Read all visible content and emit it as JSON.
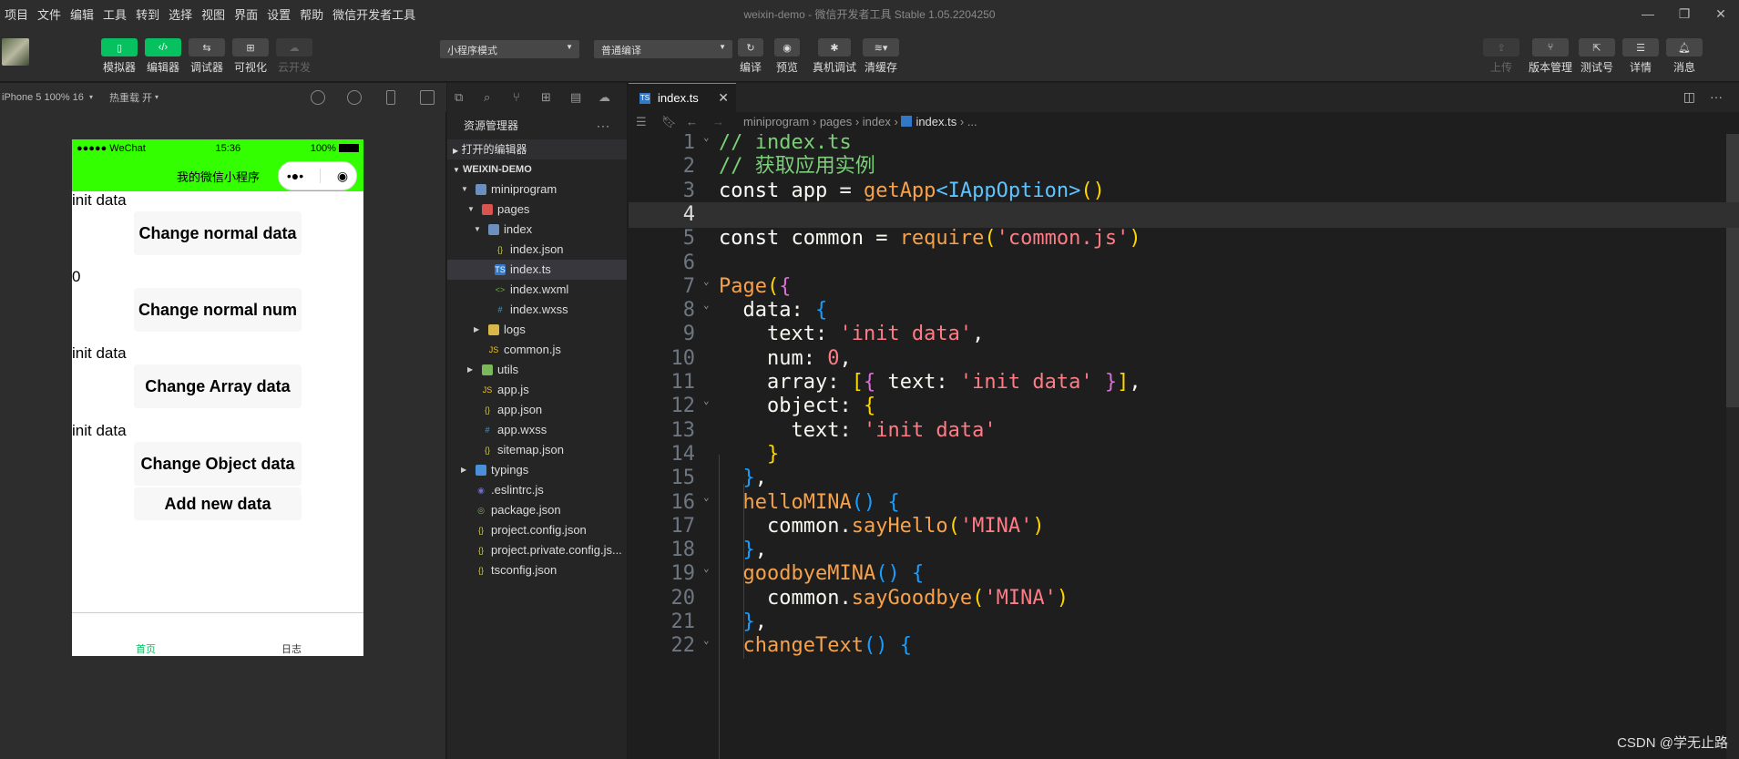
{
  "menubar": {
    "items": [
      "项目",
      "文件",
      "编辑",
      "工具",
      "转到",
      "选择",
      "视图",
      "界面",
      "设置",
      "帮助",
      "微信开发者工具"
    ],
    "title": "weixin-demo - 微信开发者工具 Stable 1.05.2204250"
  },
  "toolbar": {
    "left_buttons": [
      {
        "label": "模拟器",
        "icon": "phone-icon",
        "active": true
      },
      {
        "label": "编辑器",
        "icon": "code-icon",
        "active": true
      },
      {
        "label": "调试器",
        "icon": "debug-icon",
        "active": false
      },
      {
        "label": "可视化",
        "icon": "layout-icon",
        "active": false
      },
      {
        "label": "云开发",
        "icon": "cloud-icon",
        "disabled": true
      }
    ],
    "mode_select": "小程序模式",
    "compile_select": "普通编译",
    "mid_buttons": [
      {
        "label": "编译",
        "icon": "refresh-icon"
      },
      {
        "label": "预览",
        "icon": "eye-icon"
      },
      {
        "label": "真机调试",
        "icon": "bug-icon"
      },
      {
        "label": "清缓存",
        "icon": "layers-icon"
      }
    ],
    "right_buttons": [
      {
        "label": "上传",
        "icon": "upload-icon",
        "disabled": true
      },
      {
        "label": "版本管理",
        "icon": "branch-icon"
      },
      {
        "label": "测试号",
        "icon": "external-icon"
      },
      {
        "label": "详情",
        "icon": "menu-icon"
      },
      {
        "label": "消息",
        "icon": "bell-icon"
      }
    ]
  },
  "simulator": {
    "device": "iPhone 5 100% 16",
    "hotreload": "热重载 开",
    "status_left": "●●●●● WeChat",
    "status_time": "15:36",
    "status_battery": "100%",
    "nav_title": "我的微信小程序",
    "capsule_dots": "•●•",
    "capsule_target": "◉",
    "items": [
      {
        "text": "init data",
        "button": "Change normal data"
      },
      {
        "text": "0",
        "button": "Change normal num"
      },
      {
        "text": "init data",
        "button": "Change Array data"
      },
      {
        "text": "init data",
        "button": "Change Object data"
      }
    ],
    "extra_button": "Add new data",
    "tabbar": [
      "首页",
      "日志"
    ],
    "colors": {
      "navbar": "#33ff00",
      "tab_active": "#07c160"
    }
  },
  "explorer": {
    "header": "资源管理器",
    "open_editors": "打开的编辑器",
    "project": "WEIXIN-DEMO",
    "tree": [
      {
        "name": "miniprogram",
        "depth": 1,
        "type": "folder",
        "open": true
      },
      {
        "name": "pages",
        "depth": 2,
        "type": "folder-red",
        "open": true
      },
      {
        "name": "index",
        "depth": 3,
        "type": "folder",
        "open": true
      },
      {
        "name": "index.json",
        "depth": 4,
        "type": "json"
      },
      {
        "name": "index.ts",
        "depth": 4,
        "type": "ts",
        "selected": true
      },
      {
        "name": "index.wxml",
        "depth": 4,
        "type": "wxml"
      },
      {
        "name": "index.wxss",
        "depth": 4,
        "type": "wxss"
      },
      {
        "name": "logs",
        "depth": 3,
        "type": "folder-yellow",
        "open": false
      },
      {
        "name": "common.js",
        "depth": 3,
        "type": "js"
      },
      {
        "name": "utils",
        "depth": 2,
        "type": "folder-green",
        "open": false
      },
      {
        "name": "app.js",
        "depth": 2,
        "type": "js"
      },
      {
        "name": "app.json",
        "depth": 2,
        "type": "json"
      },
      {
        "name": "app.wxss",
        "depth": 2,
        "type": "wxss"
      },
      {
        "name": "sitemap.json",
        "depth": 2,
        "type": "json"
      },
      {
        "name": "typings",
        "depth": 1,
        "type": "folder-blue",
        "open": false
      },
      {
        "name": ".eslintrc.js",
        "depth": 1,
        "type": "eslint"
      },
      {
        "name": "package.json",
        "depth": 1,
        "type": "package"
      },
      {
        "name": "project.config.json",
        "depth": 1,
        "type": "json"
      },
      {
        "name": "project.private.config.js...",
        "depth": 1,
        "type": "json"
      },
      {
        "name": "tsconfig.json",
        "depth": 1,
        "type": "json"
      }
    ]
  },
  "editor": {
    "tab": "index.ts",
    "breadcrumb": [
      "miniprogram",
      "pages",
      "index",
      "index.ts",
      "..."
    ],
    "current_line": 4,
    "lines": [
      {
        "n": "1",
        "fold": true,
        "tokens": [
          [
            "c-cm",
            "// index.ts"
          ]
        ]
      },
      {
        "n": "2",
        "fold": false,
        "tokens": [
          [
            "c-cm",
            "// 获取应用实例"
          ]
        ]
      },
      {
        "n": "3",
        "fold": false,
        "tokens": [
          [
            "c-kw",
            "const"
          ],
          [
            "c-pr",
            " app = "
          ],
          [
            "c-fn",
            "getApp"
          ],
          [
            "c-ty",
            "<IAppOption>"
          ],
          [
            "c-p1",
            "()"
          ]
        ]
      },
      {
        "n": "4",
        "fold": false,
        "tokens": []
      },
      {
        "n": "5",
        "fold": false,
        "tokens": [
          [
            "c-kw",
            "const"
          ],
          [
            "c-pr",
            " common = "
          ],
          [
            "c-fn",
            "require"
          ],
          [
            "c-p1",
            "("
          ],
          [
            "c-st",
            "'common.js'"
          ],
          [
            "c-p1",
            ")"
          ]
        ]
      },
      {
        "n": "6",
        "fold": false,
        "tokens": []
      },
      {
        "n": "7",
        "fold": true,
        "tokens": [
          [
            "c-fn",
            "Page"
          ],
          [
            "c-p1",
            "("
          ],
          [
            "c-p2",
            "{"
          ]
        ]
      },
      {
        "n": "8",
        "fold": true,
        "tokens": [
          [
            "c-pr",
            "  data: "
          ],
          [
            "c-p3",
            "{"
          ]
        ]
      },
      {
        "n": "9",
        "fold": false,
        "tokens": [
          [
            "c-pr",
            "    text: "
          ],
          [
            "c-st",
            "'init data'"
          ],
          [
            "c-pr",
            ","
          ]
        ]
      },
      {
        "n": "10",
        "fold": false,
        "tokens": [
          [
            "c-pr",
            "    num: "
          ],
          [
            "c-nu",
            "0"
          ],
          [
            "c-pr",
            ","
          ]
        ]
      },
      {
        "n": "11",
        "fold": false,
        "tokens": [
          [
            "c-pr",
            "    array: "
          ],
          [
            "c-p1",
            "["
          ],
          [
            "c-p2",
            "{"
          ],
          [
            "c-pr",
            " text: "
          ],
          [
            "c-st",
            "'init data'"
          ],
          [
            "c-pr",
            " "
          ],
          [
            "c-p2",
            "}"
          ],
          [
            "c-p1",
            "]"
          ],
          [
            "c-pr",
            ","
          ]
        ]
      },
      {
        "n": "12",
        "fold": true,
        "tokens": [
          [
            "c-pr",
            "    object: "
          ],
          [
            "c-p1",
            "{"
          ]
        ]
      },
      {
        "n": "13",
        "fold": false,
        "tokens": [
          [
            "c-pr",
            "      text: "
          ],
          [
            "c-st",
            "'init data'"
          ]
        ]
      },
      {
        "n": "14",
        "fold": false,
        "tokens": [
          [
            "c-pr",
            "    "
          ],
          [
            "c-p1",
            "}"
          ]
        ]
      },
      {
        "n": "15",
        "fold": false,
        "tokens": [
          [
            "c-pr",
            "  "
          ],
          [
            "c-p3",
            "}"
          ],
          [
            "c-pr",
            ","
          ]
        ]
      },
      {
        "n": "16",
        "fold": true,
        "tokens": [
          [
            "c-pr",
            "  "
          ],
          [
            "c-fn",
            "helloMINA"
          ],
          [
            "c-p3",
            "()"
          ],
          [
            "c-pr",
            " "
          ],
          [
            "c-p3",
            "{"
          ]
        ]
      },
      {
        "n": "17",
        "fold": false,
        "tokens": [
          [
            "c-pr",
            "    common."
          ],
          [
            "c-fn",
            "sayHello"
          ],
          [
            "c-p1",
            "("
          ],
          [
            "c-st",
            "'MINA'"
          ],
          [
            "c-p1",
            ")"
          ]
        ]
      },
      {
        "n": "18",
        "fold": false,
        "tokens": [
          [
            "c-pr",
            "  "
          ],
          [
            "c-p3",
            "}"
          ],
          [
            "c-pr",
            ","
          ]
        ]
      },
      {
        "n": "19",
        "fold": true,
        "tokens": [
          [
            "c-pr",
            "  "
          ],
          [
            "c-fn",
            "goodbyeMINA"
          ],
          [
            "c-p3",
            "()"
          ],
          [
            "c-pr",
            " "
          ],
          [
            "c-p3",
            "{"
          ]
        ]
      },
      {
        "n": "20",
        "fold": false,
        "tokens": [
          [
            "c-pr",
            "    common."
          ],
          [
            "c-fn",
            "sayGoodbye"
          ],
          [
            "c-p1",
            "("
          ],
          [
            "c-st",
            "'MINA'"
          ],
          [
            "c-p1",
            ")"
          ]
        ]
      },
      {
        "n": "21",
        "fold": false,
        "tokens": [
          [
            "c-pr",
            "  "
          ],
          [
            "c-p3",
            "}"
          ],
          [
            "c-pr",
            ","
          ]
        ]
      },
      {
        "n": "22",
        "fold": true,
        "tokens": [
          [
            "c-pr",
            "  "
          ],
          [
            "c-fn",
            "changeText"
          ],
          [
            "c-p3",
            "()"
          ],
          [
            "c-pr",
            " "
          ],
          [
            "c-p3",
            "{"
          ]
        ]
      }
    ]
  },
  "watermark": "CSDN @学无止路"
}
